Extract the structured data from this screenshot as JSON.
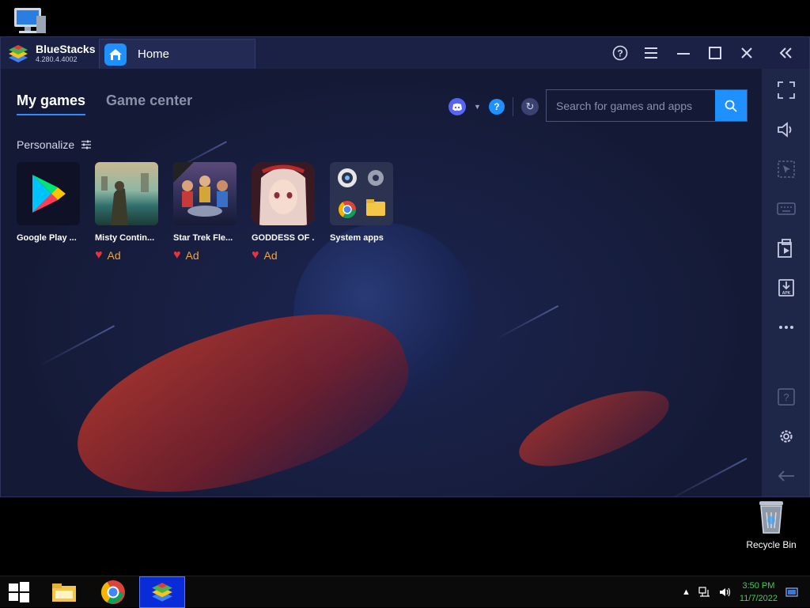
{
  "desktop": {
    "recycle_bin_label": "Recycle Bin"
  },
  "window": {
    "app_name": "BlueStacks",
    "version": "4.280.4.4002",
    "tab_label": "Home"
  },
  "nav": {
    "tabs": [
      {
        "label": "My games",
        "active": true
      },
      {
        "label": "Game center",
        "active": false
      }
    ]
  },
  "search": {
    "placeholder": "Search for games and apps"
  },
  "personalize_label": "Personalize",
  "apps": [
    {
      "name": "Google Play ...",
      "ad": false
    },
    {
      "name": "Misty Contin...",
      "ad": true,
      "ad_label": "Ad"
    },
    {
      "name": "Star Trek Fle...",
      "ad": true,
      "ad_label": "Ad"
    },
    {
      "name": "GODDESS OF ...",
      "ad": true,
      "ad_label": "Ad"
    },
    {
      "name": "System apps",
      "ad": false
    }
  ],
  "taskbar": {
    "time": "3:50 PM",
    "date": "11/7/2022"
  },
  "colors": {
    "accent": "#1e90ff",
    "window_bg": "#141a35",
    "sidebar_bg": "#1f2749",
    "ad_text": "#f2a33a",
    "heart": "#e9323b"
  }
}
